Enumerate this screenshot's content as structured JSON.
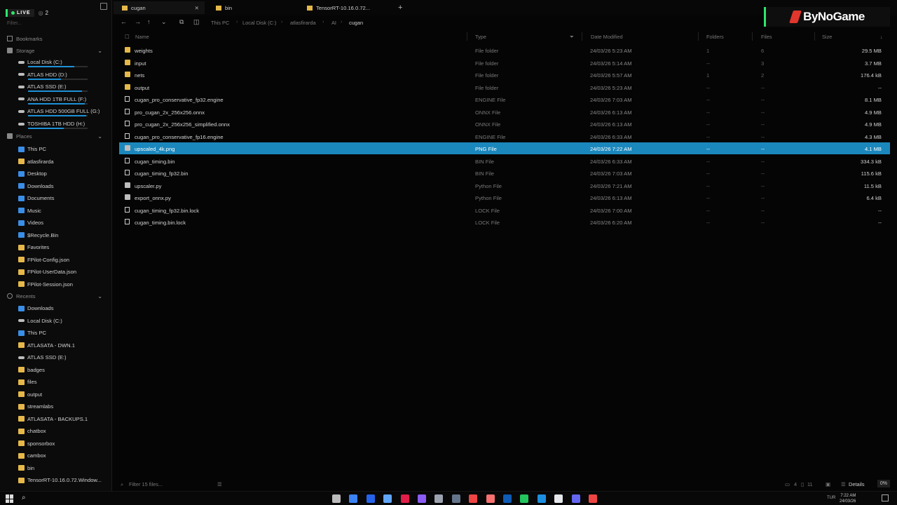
{
  "live": {
    "label": "LIVE",
    "viewers": "2"
  },
  "sidebar": {
    "filter_placeholder": "Filter...",
    "bookmarks_label": "Bookmarks",
    "storage_label": "Storage",
    "storage": [
      {
        "label": "Local Disk (C:)",
        "usage": 0.78
      },
      {
        "label": "ATLAS HDD (D:)",
        "usage": 0.55
      },
      {
        "label": "ATLAS SSD (E:)",
        "usage": 0.9
      },
      {
        "label": "ANA HDD 1TB FULL (F:)",
        "usage": 0.95
      },
      {
        "label": "ATLAS HDD 500GB FULL (G:)",
        "usage": 0.98
      },
      {
        "label": "TOSHIBA 1TB HDD (H:)",
        "usage": 0.6
      }
    ],
    "places_label": "Places",
    "places": [
      {
        "label": "This PC",
        "icon": "pc-icon"
      },
      {
        "label": "atlasfirarda",
        "icon": "folder-icon"
      },
      {
        "label": "Desktop",
        "icon": "desktop-icon"
      },
      {
        "label": "Downloads",
        "icon": "download-icon"
      },
      {
        "label": "Documents",
        "icon": "document-icon"
      },
      {
        "label": "Music",
        "icon": "music-icon"
      },
      {
        "label": "Videos",
        "icon": "video-icon"
      },
      {
        "label": "$Recycle.Bin",
        "icon": "recycle-icon"
      },
      {
        "label": "Favorites",
        "icon": "folder-icon"
      },
      {
        "label": "FPilot-Config.json",
        "icon": "folder-icon"
      },
      {
        "label": "FPilot-UserData.json",
        "icon": "folder-icon"
      },
      {
        "label": "FPilot-Session.json",
        "icon": "folder-icon"
      }
    ],
    "recents_label": "Recents",
    "recents": [
      {
        "label": "Downloads",
        "icon": "download-icon"
      },
      {
        "label": "Local Disk (C:)",
        "icon": "drive-icon"
      },
      {
        "label": "This PC",
        "icon": "pc-icon"
      },
      {
        "label": "ATLASATA - DWN.1",
        "icon": "folder-icon"
      },
      {
        "label": "ATLAS SSD (E:)",
        "icon": "drive-icon"
      },
      {
        "label": "badges",
        "icon": "folder-icon"
      },
      {
        "label": "files",
        "icon": "folder-icon"
      },
      {
        "label": "output",
        "icon": "folder-icon"
      },
      {
        "label": "streamlabs",
        "icon": "folder-icon"
      },
      {
        "label": "ATLASATA - BACKUPS.1",
        "icon": "folder-icon"
      },
      {
        "label": "chatbox",
        "icon": "folder-icon"
      },
      {
        "label": "sponsorbox",
        "icon": "folder-icon"
      },
      {
        "label": "cambox",
        "icon": "folder-icon"
      },
      {
        "label": "bin",
        "icon": "folder-icon"
      },
      {
        "label": "TensorRT-10.16.0.72.Window...",
        "icon": "folder-icon"
      }
    ]
  },
  "tabs": [
    {
      "label": "cugan",
      "active": true
    },
    {
      "label": "bin",
      "active": false
    },
    {
      "label": "TensorRT-10.16.0.72...",
      "active": false
    }
  ],
  "breadcrumb": [
    "This PC",
    "Local Disk (C:)",
    "atlasfirarda",
    "AI",
    "cugan"
  ],
  "logo": {
    "text": "ByNoGame"
  },
  "columns": {
    "name": "Name",
    "type": "Type",
    "date": "Date Modified",
    "folders": "Folders",
    "files": "Files",
    "size": "Size"
  },
  "rows": [
    {
      "name": "weights",
      "kind": "folder",
      "type": "File folder",
      "date": "24/03/26 5:23 AM",
      "folders": "1",
      "files": "6",
      "size": "29.5 MB"
    },
    {
      "name": "input",
      "kind": "folder",
      "type": "File folder",
      "date": "24/03/26 5:14 AM",
      "folders": "--",
      "files": "3",
      "size": "3.7 MB"
    },
    {
      "name": "nets",
      "kind": "folder",
      "type": "File folder",
      "date": "24/03/26 5:57 AM",
      "folders": "1",
      "files": "2",
      "size": "176.4 kB"
    },
    {
      "name": "output",
      "kind": "folder",
      "type": "File folder",
      "date": "24/03/26 5:23 AM",
      "folders": "--",
      "files": "--",
      "size": "--"
    },
    {
      "name": "cugan_pro_conservative_fp32.engine",
      "kind": "file",
      "type": "ENGINE File",
      "date": "24/03/26 7:03 AM",
      "folders": "--",
      "files": "--",
      "size": "8.1 MB"
    },
    {
      "name": "pro_cugan_2x_256x256.onnx",
      "kind": "file",
      "type": "ONNX File",
      "date": "24/03/26 6:13 AM",
      "folders": "--",
      "files": "--",
      "size": "4.9 MB"
    },
    {
      "name": "pro_cugan_2x_256x256_simplified.onnx",
      "kind": "file",
      "type": "ONNX File",
      "date": "24/03/26 6:13 AM",
      "folders": "--",
      "files": "--",
      "size": "4.9 MB"
    },
    {
      "name": "cugan_pro_conservative_fp16.engine",
      "kind": "file",
      "type": "ENGINE File",
      "date": "24/03/26 6:33 AM",
      "folders": "--",
      "files": "--",
      "size": "4.3 MB"
    },
    {
      "name": "upscaled_4k.png",
      "kind": "image",
      "type": "PNG File",
      "date": "24/03/26 7:22 AM",
      "folders": "--",
      "files": "--",
      "size": "4.1 MB",
      "selected": true
    },
    {
      "name": "cugan_timing.bin",
      "kind": "file",
      "type": "BIN File",
      "date": "24/03/26 6:33 AM",
      "folders": "--",
      "files": "--",
      "size": "334.3 kB"
    },
    {
      "name": "cugan_timing_fp32.bin",
      "kind": "file",
      "type": "BIN File",
      "date": "24/03/26 7:03 AM",
      "folders": "--",
      "files": "--",
      "size": "115.6 kB"
    },
    {
      "name": "upscaler.py",
      "kind": "python",
      "type": "Python File",
      "date": "24/03/26 7:21 AM",
      "folders": "--",
      "files": "--",
      "size": "11.5 kB"
    },
    {
      "name": "export_onnx.py",
      "kind": "python",
      "type": "Python File",
      "date": "24/03/26 6:13 AM",
      "folders": "--",
      "files": "--",
      "size": "6.4 kB"
    },
    {
      "name": "cugan_timing_fp32.bin.lock",
      "kind": "file",
      "type": "LOCK File",
      "date": "24/03/26 7:00 AM",
      "folders": "--",
      "files": "--",
      "size": "--"
    },
    {
      "name": "cugan_timing.bin.lock",
      "kind": "file",
      "type": "LOCK File",
      "date": "24/03/26 6:20 AM",
      "folders": "--",
      "files": "--",
      "size": "--"
    }
  ],
  "status": {
    "filter_placeholder": "Filter 15 files...",
    "folders_count": "4",
    "files_count": "11",
    "details_label": "Details",
    "percent": "0%"
  },
  "taskbar": {
    "time": "7:22 AM",
    "date": "24/03/26",
    "lang": "TUR"
  },
  "colors": {
    "accent": "#1b88bd",
    "live": "#2ee66b",
    "folder": "#e6b84a",
    "logo_mark": "#e0362d"
  }
}
